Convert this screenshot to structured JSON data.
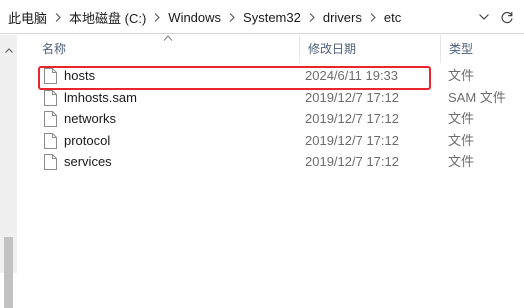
{
  "breadcrumb": [
    {
      "label": "此电脑"
    },
    {
      "label": "本地磁盘 (C:)"
    },
    {
      "label": "Windows"
    },
    {
      "label": "System32"
    },
    {
      "label": "drivers"
    },
    {
      "label": "etc"
    }
  ],
  "columns": {
    "name": "名称",
    "date": "修改日期",
    "type": "类型"
  },
  "sort": {
    "column": "name",
    "direction": "ascending"
  },
  "files": [
    {
      "name": "hosts",
      "date": "2024/6/11 19:33",
      "type": "文件",
      "icon": "file-icon",
      "highlighted": true
    },
    {
      "name": "lmhosts.sam",
      "date": "2019/12/7 17:12",
      "type": "SAM 文件",
      "icon": "file-icon"
    },
    {
      "name": "networks",
      "date": "2019/12/7 17:12",
      "type": "文件",
      "icon": "file-icon"
    },
    {
      "name": "protocol",
      "date": "2019/12/7 17:12",
      "type": "文件",
      "icon": "file-icon"
    },
    {
      "name": "services",
      "date": "2019/12/7 17:12",
      "type": "文件",
      "icon": "file-icon"
    }
  ],
  "colors": {
    "highlight": "#e8262b",
    "header_text": "#4c607a",
    "meta_text": "#6d6d6d"
  }
}
